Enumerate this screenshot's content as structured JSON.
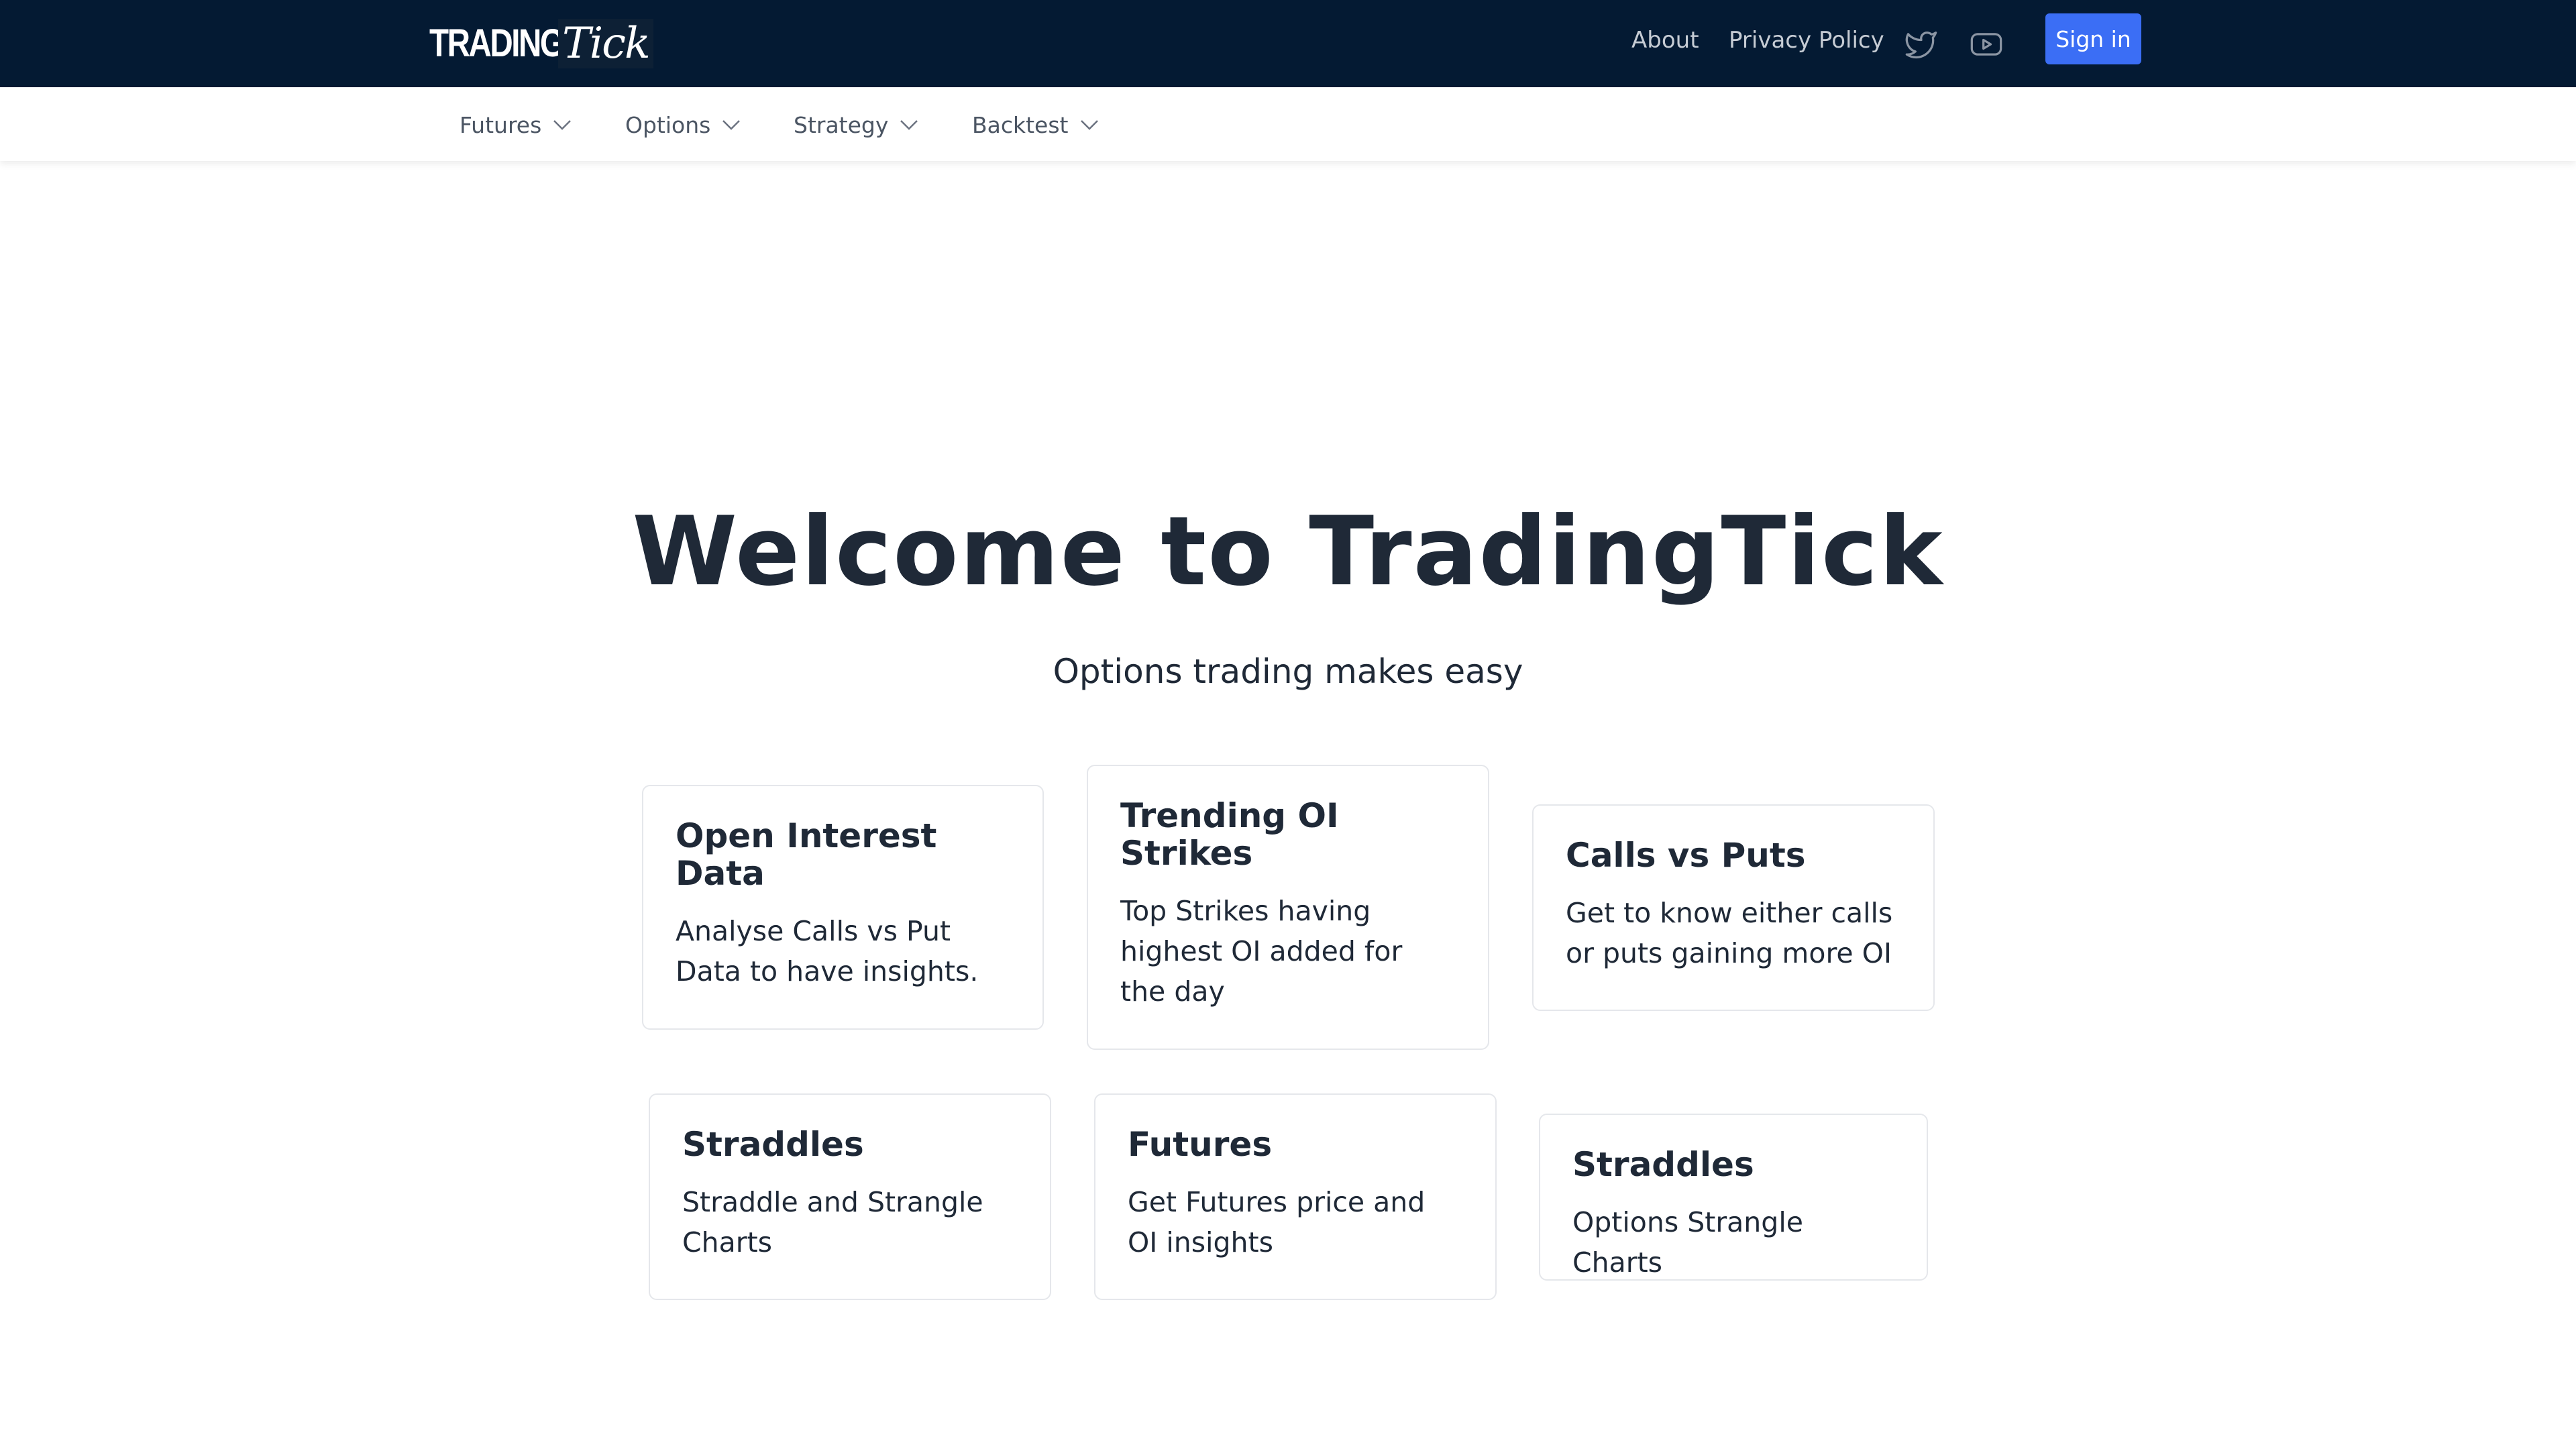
{
  "header": {
    "logo_primary": "TRADING",
    "logo_script": "Tick",
    "links": {
      "about": "About",
      "privacy": "Privacy Policy"
    },
    "icons": {
      "twitter": "twitter-icon",
      "youtube": "youtube-icon"
    },
    "signin_label": "Sign in",
    "colors": {
      "background": "#041a33",
      "signin": "#3b6ef5"
    }
  },
  "nav": {
    "items": [
      {
        "label": "Futures"
      },
      {
        "label": "Options"
      },
      {
        "label": "Strategy"
      },
      {
        "label": "Backtest"
      }
    ]
  },
  "hero": {
    "title": "Welcome to TradingTick",
    "subtitle": "Options trading makes easy"
  },
  "cards": [
    {
      "title": "Open Interest Data",
      "description": "Analyse Calls vs Put Data to have insights."
    },
    {
      "title": "Trending OI Strikes",
      "description": "Top Strikes having highest OI added for the day"
    },
    {
      "title": "Calls vs Puts",
      "description": "Get to know either calls or puts gaining more OI"
    },
    {
      "title": "Straddles",
      "description": "Straddle and Strangle Charts"
    },
    {
      "title": "Futures",
      "description": "Get Futures price and OI insights"
    },
    {
      "title": "Straddles",
      "description": "Options Strangle Charts"
    }
  ]
}
